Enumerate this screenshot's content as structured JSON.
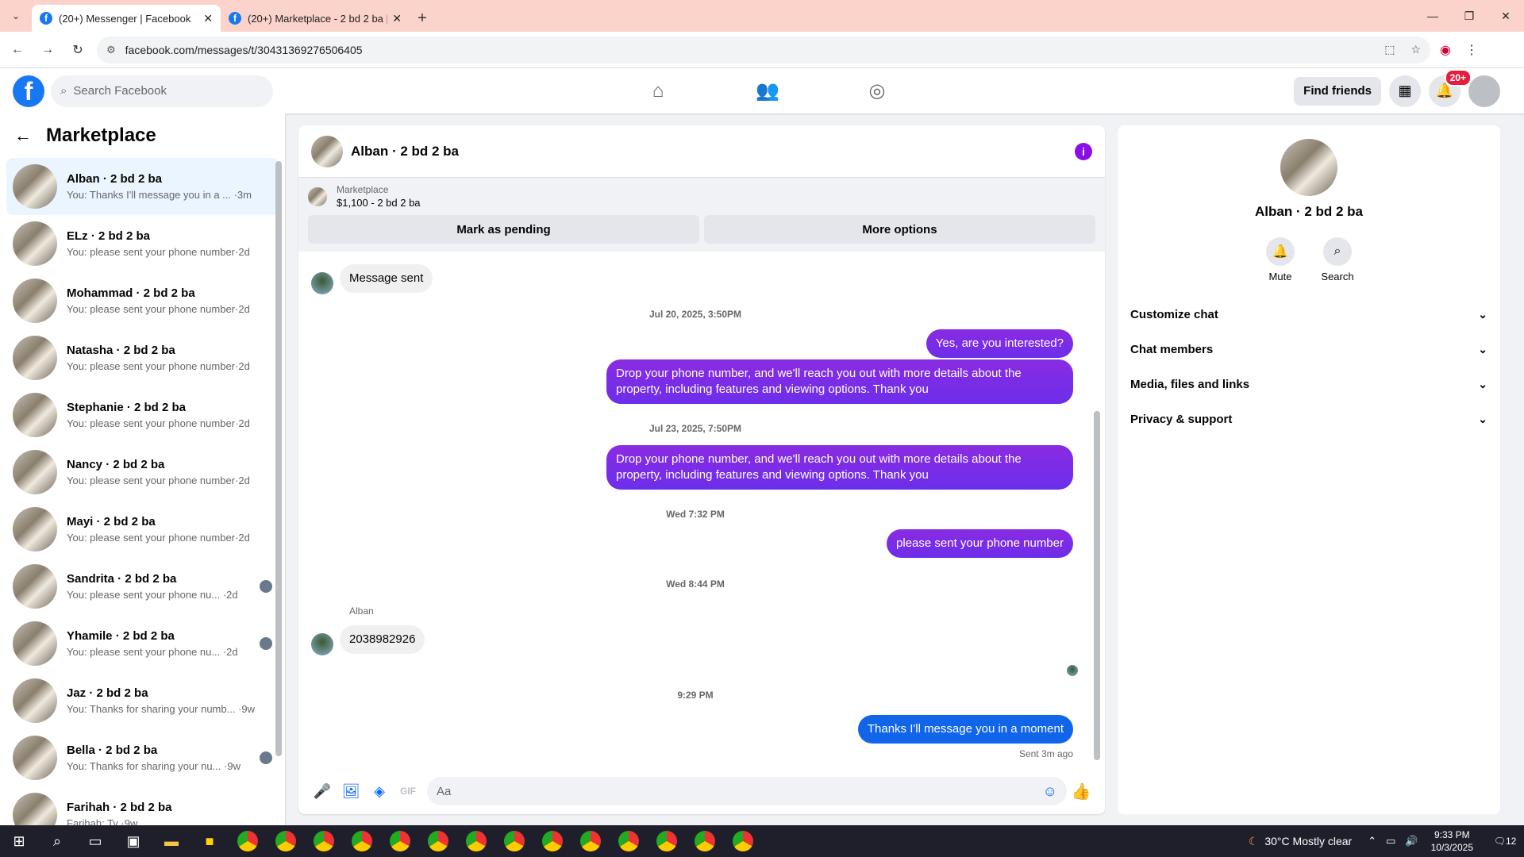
{
  "browser": {
    "tabs": [
      {
        "title": "(20+) Messenger | Facebook",
        "active": true
      },
      {
        "title": "(20+) Marketplace - 2 bd 2 ba |",
        "active": false
      }
    ],
    "url": "facebook.com/messages/t/30431369276506405"
  },
  "fb_header": {
    "search_placeholder": "Search Facebook",
    "find_friends_label": "Find friends",
    "notif_badge": "20+"
  },
  "left_panel": {
    "title": "Marketplace",
    "conversations": [
      {
        "name": "Alban · 2 bd 2 ba",
        "preview": "You: Thanks I'll message you in a ... ·3m"
      },
      {
        "name": "ELz · 2 bd 2 ba",
        "preview": "You: please sent your phone number·2d"
      },
      {
        "name": "Mohammad · 2 bd 2 ba",
        "preview": "You: please sent your phone number·2d"
      },
      {
        "name": "Natasha · 2 bd 2 ba",
        "preview": "You: please sent your phone number·2d"
      },
      {
        "name": "Stephanie · 2 bd 2 ba",
        "preview": "You: please sent your phone number·2d"
      },
      {
        "name": "Nancy · 2 bd 2 ba",
        "preview": "You: please sent your phone number·2d"
      },
      {
        "name": "Mayi · 2 bd 2 ba",
        "preview": "You: please sent your phone number·2d"
      },
      {
        "name": "Sandrita · 2 bd 2 ba",
        "preview": "You: please sent your phone nu... ·2d"
      },
      {
        "name": "Yhamile · 2 bd 2 ba",
        "preview": "You: please sent your phone nu... ·2d"
      },
      {
        "name": "Jaz · 2 bd 2 ba",
        "preview": "You: Thanks for sharing your numb... ·9w"
      },
      {
        "name": "Bella · 2 bd 2 ba",
        "preview": "You: Thanks for sharing your nu... ·9w"
      },
      {
        "name": "Farihah · 2 bd 2 ba",
        "preview": "Farihah: Ty ·9w"
      }
    ]
  },
  "chat": {
    "title": "Alban · 2 bd 2 ba",
    "marketplace_label": "Marketplace",
    "listing": "$1,100 - 2 bd 2 ba",
    "mark_pending": "Mark as pending",
    "more_options": "More options",
    "msg_sent": "Message sent",
    "ts1": "Jul 20, 2025, 3:50PM",
    "m1": "Yes, are you interested?",
    "m2": "Drop your phone number, and we'll reach you out with more details about the property, including features and viewing options.  Thank you",
    "ts2": "Jul 23, 2025, 7:50PM",
    "m3": "Drop your phone number, and we'll reach you out with more details about the property, including features and viewing options.  Thank you",
    "ts3": "Wed 7:32 PM",
    "m4": "please sent your phone number",
    "ts4": "Wed 8:44 PM",
    "sender": "Alban",
    "m5": "2038982926",
    "ts5": "9:29 PM",
    "m6": "Thanks I'll message you in a moment",
    "sent_status": "Sent 3m ago",
    "composer_placeholder": "Aa"
  },
  "right_panel": {
    "name": "Alban · 2 bd 2 ba",
    "mute": "Mute",
    "search": "Search",
    "sections": [
      "Customize chat",
      "Chat members",
      "Media, files and links",
      "Privacy & support"
    ]
  },
  "taskbar": {
    "weather": "30°C  Mostly clear",
    "time": "9:33 PM",
    "date": "10/3/2025",
    "notif_count": "12"
  }
}
